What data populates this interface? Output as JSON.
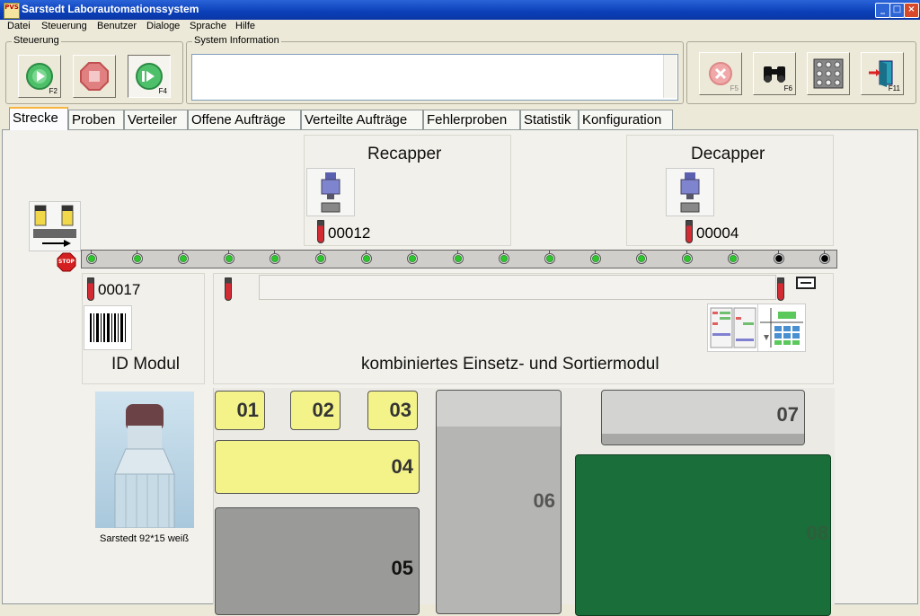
{
  "window": {
    "title": "Sarstedt Laborautomationssystem",
    "icon_text": "PVS"
  },
  "menu": [
    "Datei",
    "Steuerung",
    "Benutzer",
    "Dialoge",
    "Sprache",
    "Hilfe"
  ],
  "toolbar": {
    "steuerung_label": "Steuerung",
    "sysinfo_label": "System Information",
    "start_key": "F2",
    "stop_key": "",
    "step_key": "F4",
    "cancel_key": "F5",
    "search_key": "F6",
    "grid_key": "",
    "exit_key": "F11"
  },
  "tabs": [
    "Strecke",
    "Proben",
    "Verteiler",
    "Offene Aufträge",
    "Verteilte Aufträge",
    "Fehlerproben",
    "Statistik",
    "Konfiguration"
  ],
  "recapper": {
    "title": "Recapper",
    "tube_id": "00012"
  },
  "decapper": {
    "title": "Decapper",
    "tube_id": "00004"
  },
  "id_modul": {
    "title": "ID Modul",
    "tube_id": "00017"
  },
  "sort_modul": {
    "title": "kombiniertes Einsetz- und Sortiermodul"
  },
  "stop_sign": "STOP",
  "tube_image": {
    "caption": "Sarstedt 92*15 weiß"
  },
  "slots": {
    "s01": "01",
    "s02": "02",
    "s03": "03",
    "s04": "04",
    "s05": "05",
    "s06": "06",
    "s07": "07",
    "s08": "08"
  },
  "colors": {
    "titlebar": "#0a3fb8",
    "slot_yellow": "#f3f38a",
    "slot_gray": "#9a9a98",
    "slot_green": "#1a6e3a",
    "station_green": "#2dc62d"
  }
}
